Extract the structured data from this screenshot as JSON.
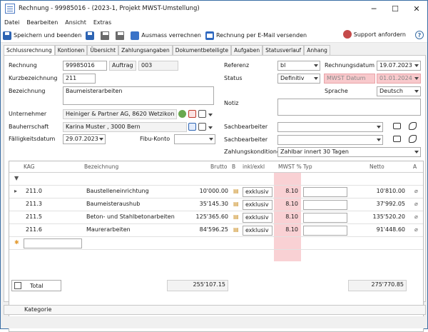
{
  "window": {
    "title": "Rechnung - 99985016 -  (2023-1, Projekt MWST-Umstellung)"
  },
  "menu": [
    "Datei",
    "Bearbeiten",
    "Ansicht",
    "Extras"
  ],
  "toolbar": {
    "save_close": "Speichern und beenden",
    "ausmass": "Ausmass verrechnen",
    "email": "Rechnung per E-Mail versenden",
    "support": "Support anfordern"
  },
  "tabs": [
    "Schlussrechnung",
    "Kontionen",
    "Übersicht",
    "Zahlungsangaben",
    "Dokumentbeteiligte",
    "Aufgaben",
    "Statusverlauf",
    "Anhang"
  ],
  "form": {
    "rechnung_label": "Rechnung",
    "rechnung_value": "99985016",
    "auftrag_label": "Auftrag",
    "auftrag_value": "003",
    "kurz_label": "Kurzbezeichnung",
    "kurz_value": "211",
    "bez_label": "Bezeichnung",
    "bez_value": "Baumeisterarbeiten",
    "unternehmer_label": "Unternehmer",
    "unternehmer_value": "Heiniger & Partner AG, 8620 Wetzikon ZH",
    "bauherr_label": "Bauherrschaft",
    "bauherr_value": "Karina Muster , 3000 Bern",
    "faellig_label": "Fälligkeitsdatum",
    "faellig_value": "29.07.2023",
    "fibu_label": "Fibu-Konto",
    "fibu_value": "",
    "referenz_label": "Referenz",
    "referenz_value": "bl",
    "status_label": "Status",
    "status_value": "Definitiv",
    "rdatum_label": "Rechnungsdatum",
    "rdatum_value": "19.07.2023",
    "mwst_label": "MWST Datum",
    "mwst_value": "01.01.2024",
    "sprache_label": "Sprache",
    "sprache_value": "Deutsch",
    "notiz_label": "Notiz",
    "sach1_label": "Sachbearbeiter",
    "sach2_label": "Sachbearbeiter",
    "zahl_label": "Zahlungskonditionen",
    "zahl_value": "Zahlbar innert 30 Tagen"
  },
  "grid": {
    "headers": [
      "KAG",
      "Bezeichnung",
      "Brutto",
      "B",
      "inkl/exkl",
      "MWST %",
      "Typ",
      "Netto",
      "A"
    ],
    "rows": [
      {
        "kag": "211.0",
        "bez": "Baustelleneinrichtung",
        "brutto": "10'000.00",
        "inkl": "exklusiv",
        "mwst": "8.10",
        "typ": "",
        "netto": "10'810.00"
      },
      {
        "kag": "211.3",
        "bez": "Baumeisteraushub",
        "brutto": "35'145.30",
        "inkl": "exklusiv",
        "mwst": "8.10",
        "typ": "",
        "netto": "37'992.05"
      },
      {
        "kag": "211.5",
        "bez": "Beton- und Stahlbetonarbeiten",
        "brutto": "125'365.60",
        "inkl": "exklusiv",
        "mwst": "8.10",
        "typ": "",
        "netto": "135'520.20"
      },
      {
        "kag": "211.6",
        "bez": "Maurerarbeiten",
        "brutto": "84'596.25",
        "inkl": "exklusiv",
        "mwst": "8.10",
        "typ": "",
        "netto": "91'448.60"
      }
    ],
    "total_label": "Total",
    "total_brutto": "255'107.15",
    "total_netto": "275'770.85"
  },
  "kategorie": "Kategorie",
  "colors": {
    "accent": "#2d64b3",
    "mwst_highlight": "#f8c9cc"
  }
}
